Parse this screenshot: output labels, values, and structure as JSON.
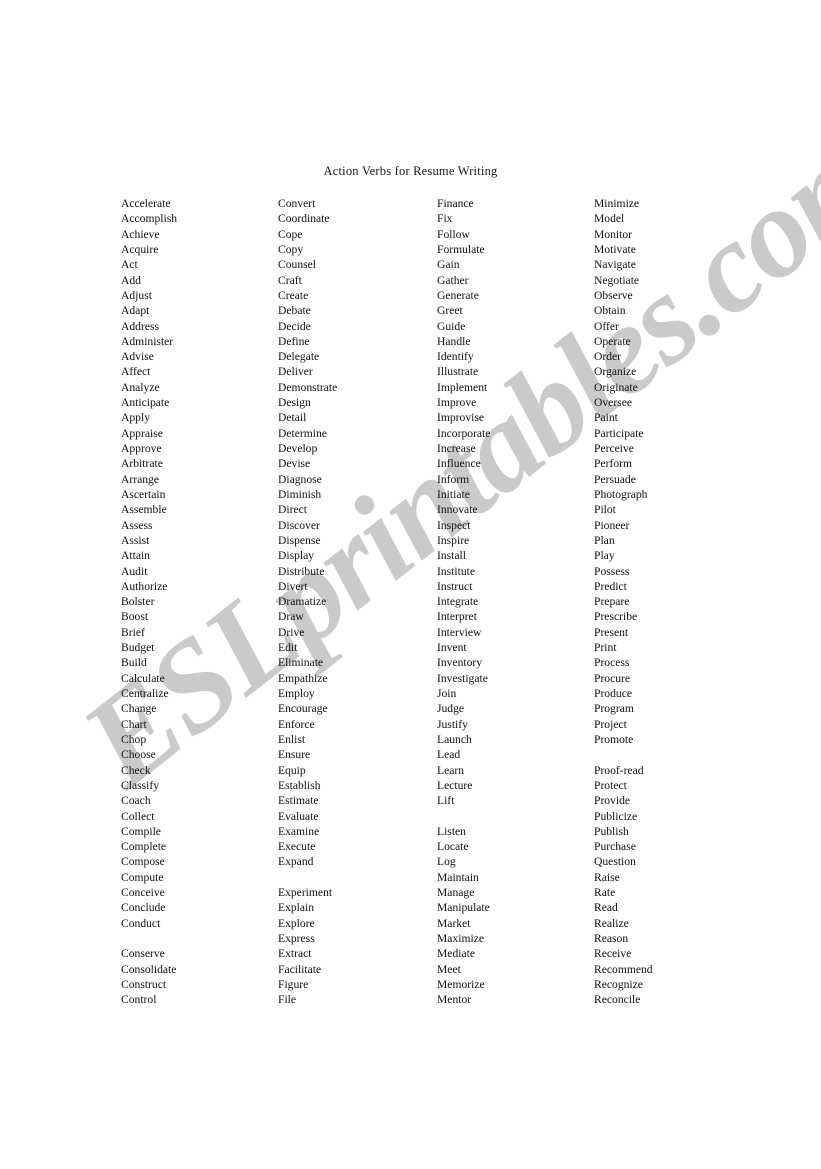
{
  "document": {
    "title": "Action Verbs for Resume Writing",
    "watermark": "ESLprintables.com",
    "watermark_color": "#c8c8c8",
    "background_color": "#ffffff",
    "text_color": "#000000"
  },
  "columns": [
    {
      "index": 1,
      "items": [
        "Accelerate",
        "Accomplish",
        "Achieve",
        "Acquire",
        "Act",
        "Add",
        "Adjust",
        "Adapt",
        "Address",
        "Administer",
        "Advise",
        "Affect",
        "Analyze",
        "Anticipate",
        "Apply",
        "Appraise",
        "Approve",
        "Arbitrate",
        "Arrange",
        "Ascertain",
        "Assemble",
        "Assess",
        "Assist",
        "Attain",
        "Audit",
        "Authorize",
        "Bolster",
        "Boost",
        "Brief",
        "Budget",
        "Build",
        "Calculate",
        "Centralize",
        "Change",
        "Chart",
        "Chop",
        "Choose",
        "Check",
        "Classify",
        "Coach",
        "Collect",
        "Compile",
        "Complete",
        "Compose",
        "Compute",
        "Conceive",
        "Conclude",
        "Conduct",
        "",
        "Conserve",
        "Consolidate",
        "Construct",
        "Control"
      ]
    },
    {
      "index": 2,
      "items": [
        "Convert",
        "Coordinate",
        "Cope",
        "Copy",
        "Counsel",
        "Craft",
        "Create",
        "Debate",
        "Decide",
        "Define",
        "Delegate",
        "Deliver",
        "Demonstrate",
        "Design",
        "Detail",
        "Determine",
        "Develop",
        "Devise",
        "Diagnose",
        "Diminish",
        "Direct",
        "Discover",
        "Dispense",
        "Display",
        "Distribute",
        "Divert",
        "Dramatize",
        "Draw",
        "Drive",
        "Edit",
        "Eliminate",
        "Empathize",
        "Employ",
        "Encourage",
        "Enforce",
        "Enlist",
        "Ensure",
        "Equip",
        "Establish",
        "Estimate",
        "Evaluate",
        "Examine",
        "Execute",
        "Expand",
        "",
        "Experiment",
        "Explain",
        "Explore",
        "Express",
        "Extract",
        "Facilitate",
        "Figure",
        "File"
      ]
    },
    {
      "index": 3,
      "items": [
        "Finance",
        "Fix",
        "Follow",
        "Formulate",
        "Gain",
        "Gather",
        "Generate",
        "Greet",
        "Guide",
        "Handle",
        "Identify",
        "Illustrate",
        "Implement",
        "Improve",
        "Improvise",
        "Incorporate",
        "Increase",
        "Influence",
        "Inform",
        "Initiate",
        "Innovate",
        "Inspect",
        "Inspire",
        "Install",
        "Institute",
        "Instruct",
        "Integrate",
        "Interpret",
        "Interview",
        "Invent",
        "Inventory",
        "Investigate",
        "Join",
        "Judge",
        "Justify",
        "Launch",
        "Lead",
        "Learn",
        "Lecture",
        "Lift",
        "",
        "Listen",
        "Locate",
        "Log",
        "Maintain",
        "Manage",
        "Manipulate",
        "Market",
        "Maximize",
        "Mediate",
        "Meet",
        "Memorize",
        "Mentor"
      ]
    },
    {
      "index": 4,
      "items": [
        "Minimize",
        "Model",
        "Monitor",
        "Motivate",
        "Navigate",
        "Negotiate",
        "Observe",
        "Obtain",
        "Offer",
        "Operate",
        "Order",
        "Organize",
        "Originate",
        "Oversee",
        "Paint",
        "Participate",
        "Perceive",
        "Perform",
        "Persuade",
        "Photograph",
        "Pilot",
        "Pioneer",
        "Plan",
        "Play",
        "Possess",
        "Predict",
        "Prepare",
        "Prescribe",
        "Present",
        "Print",
        "Process",
        "Procure",
        "Produce",
        "Program",
        "Project",
        "Promote",
        "",
        "Proof-read",
        "Protect",
        "Provide",
        "Publicize",
        "Publish",
        "Purchase",
        "Question",
        "Raise",
        "Rate",
        "Read",
        "Realize",
        "Reason",
        "Receive",
        "Recommend",
        "Recognize",
        "Reconcile"
      ]
    }
  ]
}
